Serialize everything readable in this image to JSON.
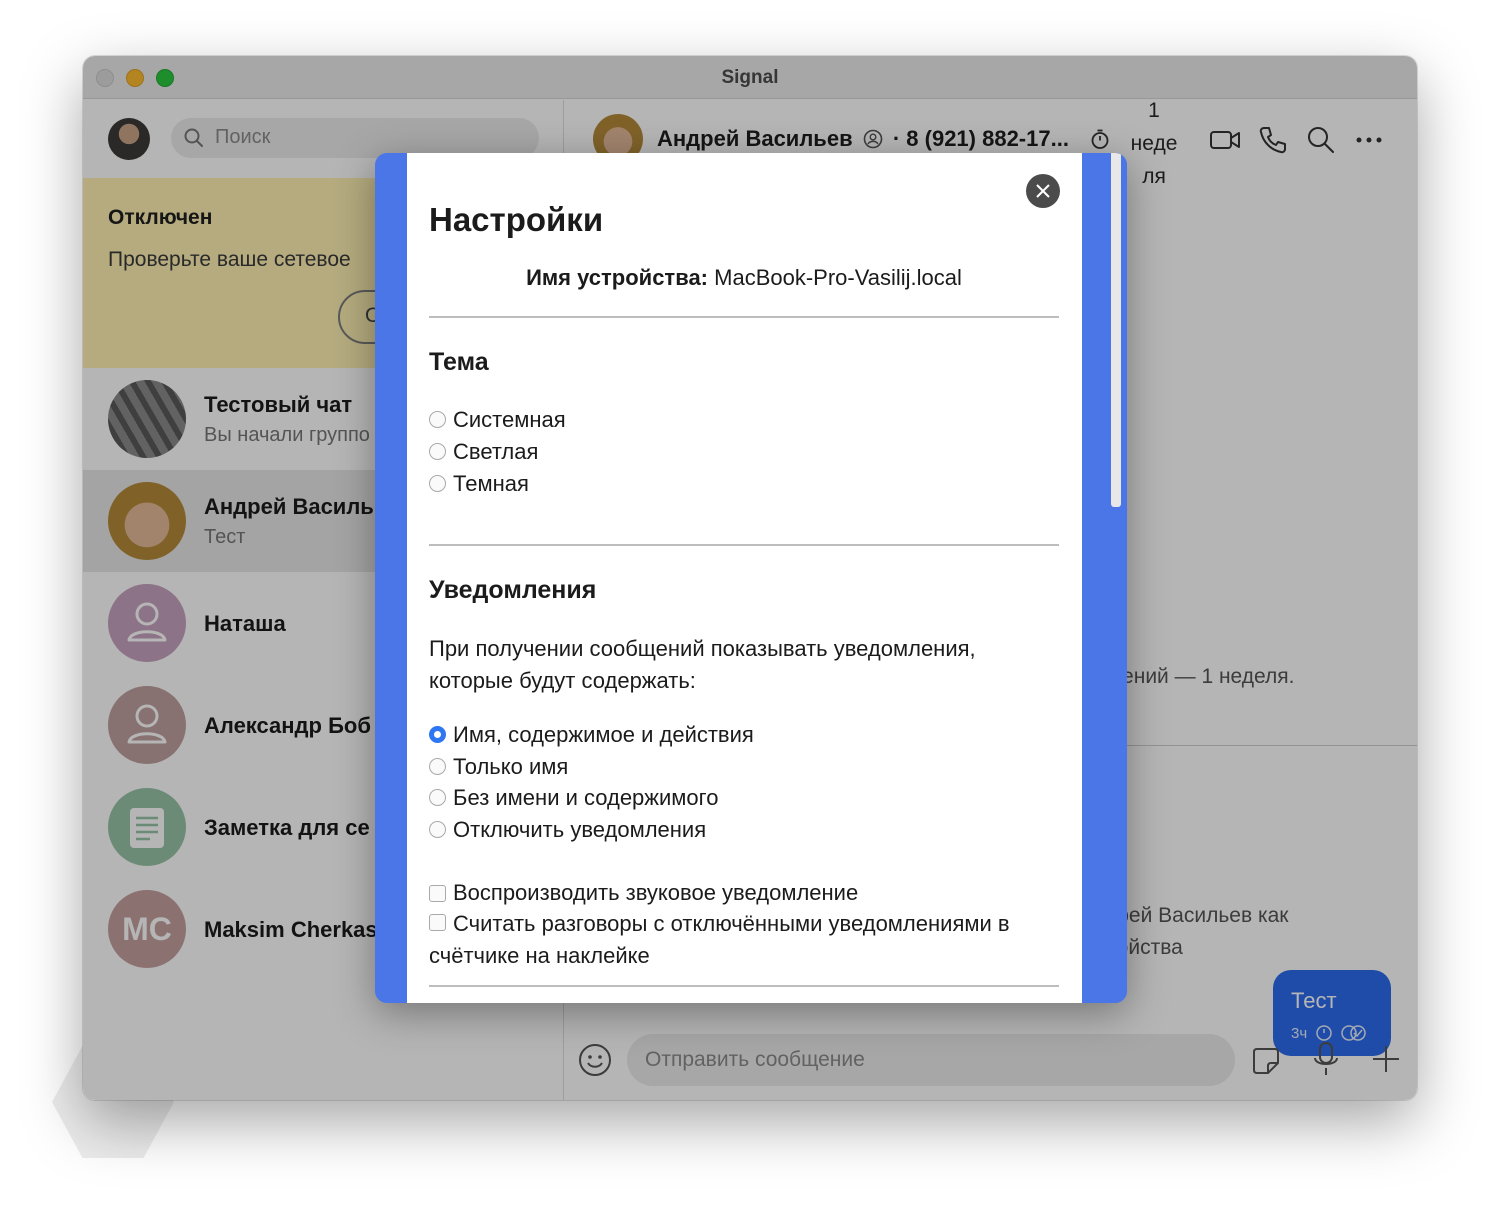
{
  "window": {
    "title": "Signal"
  },
  "sidebar": {
    "search_placeholder": "Поиск",
    "banner": {
      "title": "Отключен",
      "text": "Проверьте ваше сетевое",
      "button": "О"
    },
    "conversations": [
      {
        "name": "Тестовый чат",
        "preview": "Вы начали группо",
        "avatar": "keyboard-photo"
      },
      {
        "name": "Андрей Василь",
        "preview": "Тест",
        "avatar": "face-photo",
        "active": true
      },
      {
        "name": "Наташа",
        "preview": "",
        "avatar": "person-icon",
        "color": "#c7a2be"
      },
      {
        "name": "Александр Боб",
        "preview": "",
        "avatar": "person-icon",
        "color": "#c0a0a0"
      },
      {
        "name": "Заметка для се",
        "preview": "",
        "avatar": "note-icon",
        "color": "#98c4a8"
      },
      {
        "name": "Maksim Cherkas",
        "preview": "",
        "avatar_initials": "MC",
        "color": "#c6a0a0"
      }
    ]
  },
  "conversation_header": {
    "name": "Андрей Васильев",
    "phone": "· 8 (921) 882-17...",
    "timer_lines": [
      "1",
      "неде",
      "ля"
    ]
  },
  "conversation": {
    "notice": "щений — 1 неделя.",
    "safety_lines": [
      "дрей Васильев как",
      "ройства"
    ],
    "bubble": {
      "text": "Тест",
      "time": "3ч"
    },
    "composer_placeholder": "Отправить сообщение"
  },
  "settings": {
    "title": "Настройки",
    "device_label": "Имя устройства:",
    "device_name": "MacBook-Pro-Vasilij.local",
    "theme": {
      "heading": "Тема",
      "options": [
        "Системная",
        "Светлая",
        "Темная"
      ]
    },
    "notifications": {
      "heading": "Уведомления",
      "description": "При получении сообщений показывать уведомления, которые будут содержать:",
      "options": [
        "Имя, содержимое и действия",
        "Только имя",
        "Без имени и содержимого",
        "Отключить уведомления"
      ],
      "selected": "Имя, содержимое и действия",
      "play_sound": "Воспроизводить звуковое уведомление",
      "count_muted": "Считать разговоры с отключёнными уведомлениями в счётчике на наклейке"
    }
  },
  "colors": {
    "accent": "#2c6bed",
    "modal_scrollbar": "#4a76e8",
    "banner": "#fff1b4",
    "radio_selected": "#2f77f2"
  }
}
